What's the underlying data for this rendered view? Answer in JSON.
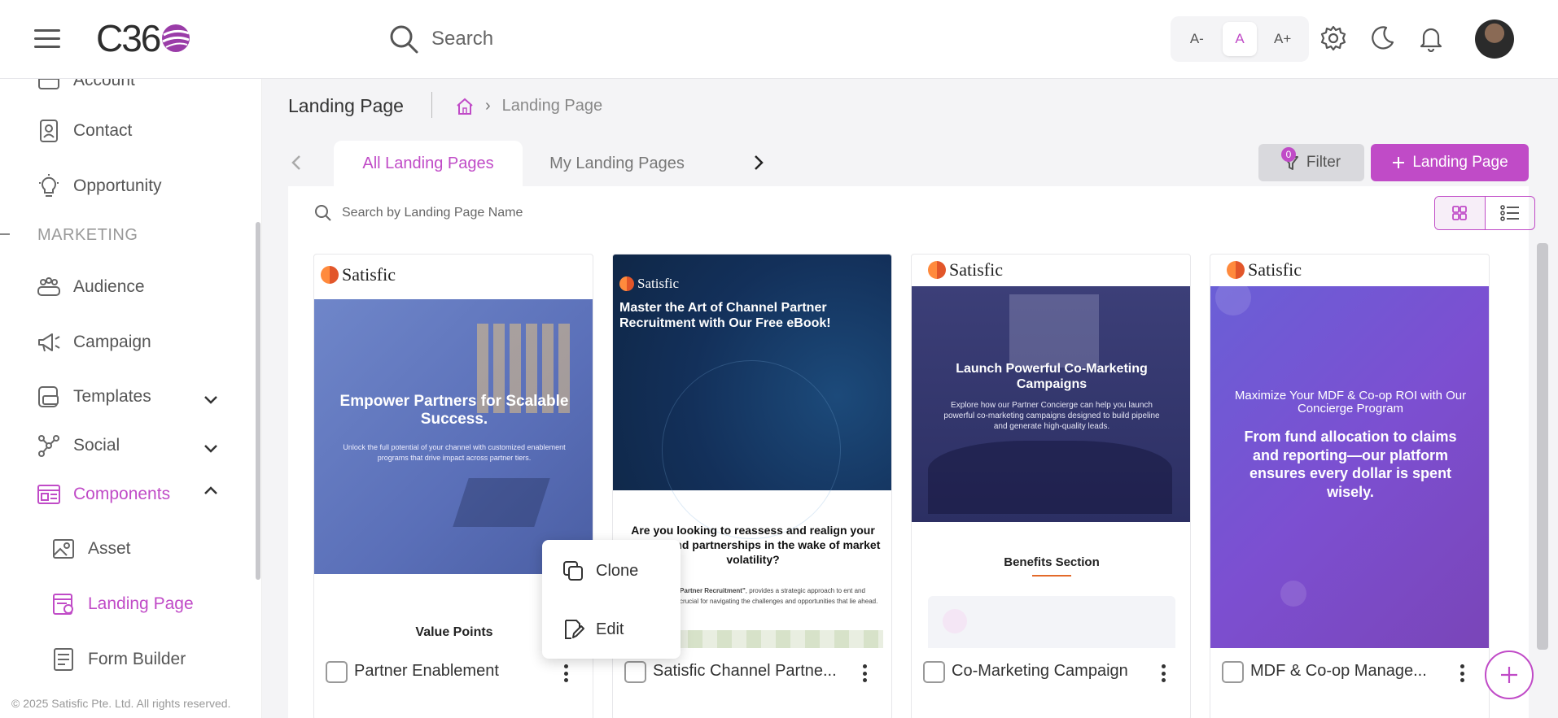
{
  "header": {
    "logo_text": "C36",
    "search_label": "Search",
    "font_size": {
      "decrease": "A-",
      "normal": "A",
      "increase": "A+",
      "selected": "A"
    },
    "icons": [
      "settings-icon",
      "moon-icon",
      "bell-icon"
    ]
  },
  "sidebar": {
    "items_top": [
      {
        "label": "Account",
        "icon": "account-icon"
      },
      {
        "label": "Contact",
        "icon": "contact-icon"
      },
      {
        "label": "Opportunity",
        "icon": "lightbulb-icon"
      }
    ],
    "section_label": "MARKETING",
    "marketing_items": [
      {
        "label": "Audience",
        "icon": "people-icon"
      },
      {
        "label": "Campaign",
        "icon": "megaphone-icon"
      },
      {
        "label": "Templates",
        "icon": "templates-icon",
        "expandable": true
      },
      {
        "label": "Social",
        "icon": "social-icon",
        "expandable": true
      },
      {
        "label": "Components",
        "icon": "components-icon",
        "expandable": true,
        "expanded": true
      }
    ],
    "sub_items": [
      {
        "label": "Asset",
        "icon": "image-icon"
      },
      {
        "label": "Landing Page",
        "icon": "landing-page-icon",
        "active": true
      },
      {
        "label": "Form Builder",
        "icon": "form-icon"
      }
    ],
    "copyright": "© 2025 Satisfic Pte. Ltd. All rights reserved."
  },
  "page": {
    "title": "Landing Page",
    "breadcrumb_current": "Landing Page"
  },
  "tabs": [
    {
      "label": "All Landing Pages",
      "active": true
    },
    {
      "label": "My Landing Pages",
      "active": false
    }
  ],
  "toolbar": {
    "filter_label": "Filter",
    "filter_count": "0",
    "add_label": "Landing Page"
  },
  "list_search": {
    "placeholder": "Search by Landing Page Name"
  },
  "cards": [
    {
      "name": "Partner Enablement",
      "brand": "Satisfic",
      "headline": "Empower Partners for Scalable Success.",
      "body": "Unlock the full potential of your channel with customized enablement programs that drive impact across partner tiers.",
      "section": "Value Points"
    },
    {
      "name": "Satisfic Channel Partne...",
      "brand": "Satisfic",
      "headline": "Master the Art of Channel Partner Recruitment with Our Free eBook!",
      "question": "Are you looking to reassess and realign your models and partnerships in the wake of market volatility?",
      "body_bold": "ing Channel Partner Recruitment\"",
      "body": ", provides a strategic approach to ent and onboarding that's crucial for navigating the challenges and opportunities that lie ahead."
    },
    {
      "name": "Co-Marketing Campaign",
      "brand": "Satisfic",
      "headline": "Launch Powerful Co-Marketing Campaigns",
      "body": "Explore how our Partner Concierge can help you launch powerful co-marketing campaigns designed to build pipeline and generate high-quality leads.",
      "section": "Benefits Section"
    },
    {
      "name": "MDF & Co-op Manage...",
      "brand": "Satisfic",
      "headline": "Maximize Your MDF & Co-op ROI with Our Concierge Program",
      "body": "From fund allocation to claims and reporting—our platform ensures every dollar is spent wisely."
    }
  ],
  "context_menu": {
    "items": [
      {
        "label": "Clone",
        "icon": "clone-icon"
      },
      {
        "label": "Edit",
        "icon": "edit-icon"
      }
    ]
  },
  "colors": {
    "accent": "#c04bc7",
    "navy": "#13305a",
    "purple_grad": "#7c4fd1"
  }
}
